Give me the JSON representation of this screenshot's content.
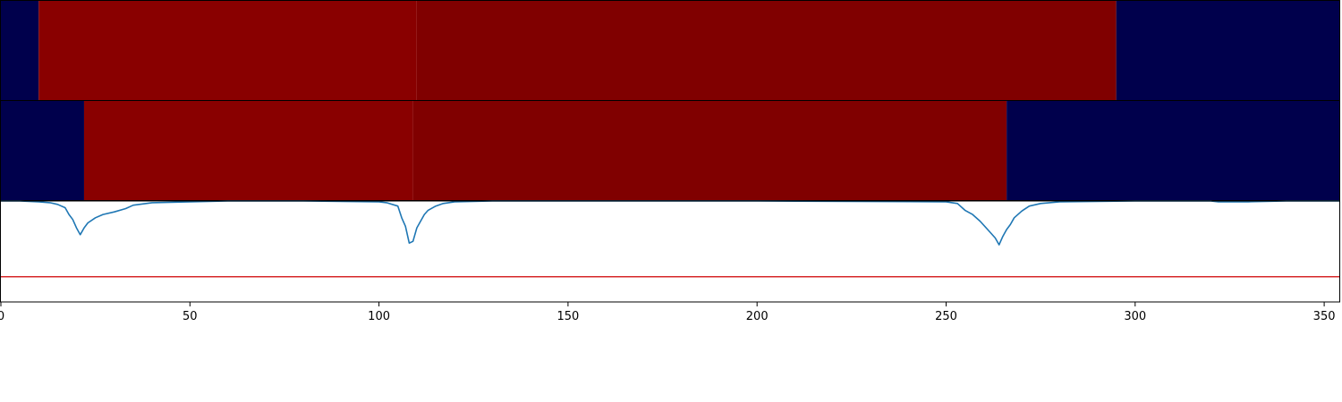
{
  "chart_data": {
    "type": "heatmap",
    "xlim": [
      0,
      354
    ],
    "x_ticks": [
      0,
      50,
      100,
      150,
      200,
      250,
      300,
      350
    ],
    "x_tick_labels": [
      "0",
      "50",
      "100",
      "150",
      "200",
      "250",
      "300",
      "350"
    ],
    "colors": {
      "low": "#00004c",
      "high_1": "#890000",
      "high_2": "#800000",
      "signal": "#1f77b4",
      "threshold": "#d62728"
    },
    "segment_rows": [
      {
        "segments": [
          {
            "start": 0,
            "end": 10,
            "level": "low"
          },
          {
            "start": 10,
            "end": 110,
            "level": "high_1"
          },
          {
            "start": 110,
            "end": 295,
            "level": "high_2"
          },
          {
            "start": 295,
            "end": 354,
            "level": "low"
          }
        ]
      },
      {
        "segments": [
          {
            "start": 0,
            "end": 22,
            "level": "low"
          },
          {
            "start": 22,
            "end": 109,
            "level": "high_1"
          },
          {
            "start": 109,
            "end": 266,
            "level": "high_2"
          },
          {
            "start": 266,
            "end": 354,
            "level": "low"
          }
        ]
      }
    ],
    "line_panel": {
      "ylim": [
        -0.2,
        1.0
      ],
      "threshold": 0.1,
      "signal": {
        "x": [
          0,
          5,
          10,
          13,
          15,
          17,
          18,
          19,
          20,
          21,
          22,
          23,
          25,
          27,
          30,
          33,
          35,
          40,
          50,
          60,
          80,
          100,
          102,
          105,
          106,
          107,
          108,
          109,
          110,
          111,
          112,
          113,
          115,
          117,
          120,
          130,
          150,
          200,
          250,
          253,
          255,
          257,
          259,
          261,
          263,
          264,
          265,
          266,
          267,
          268,
          270,
          272,
          275,
          280,
          300,
          320,
          322,
          330,
          340,
          354
        ],
        "y": [
          1.0,
          1.0,
          0.99,
          0.98,
          0.96,
          0.92,
          0.84,
          0.78,
          0.68,
          0.6,
          0.68,
          0.74,
          0.8,
          0.84,
          0.87,
          0.91,
          0.95,
          0.98,
          0.99,
          1.0,
          1.0,
          0.99,
          0.98,
          0.94,
          0.8,
          0.7,
          0.5,
          0.52,
          0.68,
          0.76,
          0.84,
          0.89,
          0.94,
          0.97,
          0.99,
          1.0,
          1.0,
          1.0,
          0.99,
          0.97,
          0.89,
          0.84,
          0.76,
          0.66,
          0.56,
          0.48,
          0.58,
          0.66,
          0.72,
          0.8,
          0.88,
          0.94,
          0.97,
          0.99,
          1.0,
          1.0,
          0.99,
          0.99,
          1.0,
          1.0
        ]
      }
    }
  }
}
